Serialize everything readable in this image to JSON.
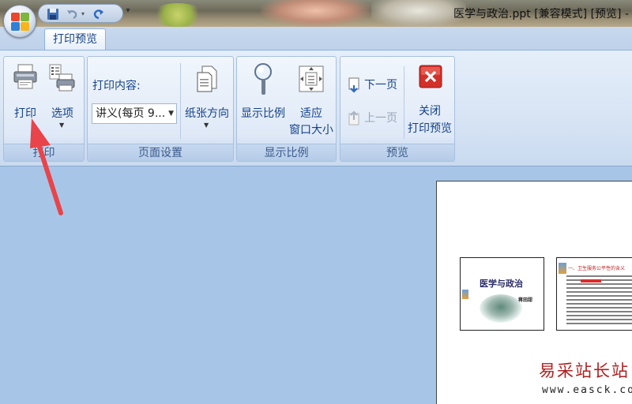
{
  "window": {
    "title": "医学与政治.ppt [兼容模式] [预览] -"
  },
  "tabs": [
    {
      "label": "打印预览"
    }
  ],
  "groups": {
    "print": {
      "label": "打印",
      "print_button": "打印",
      "options_button": "选项"
    },
    "page_setup": {
      "label": "页面设置",
      "content_label": "打印内容:",
      "content_value": "讲义(每页 9...",
      "orientation_button": "纸张方向"
    },
    "zoom": {
      "label": "显示比例",
      "zoom_button": "显示比例",
      "fit_line1": "适应",
      "fit_line2": "窗口大小"
    },
    "preview": {
      "label": "预览",
      "next_page": "下一页",
      "prev_page": "上一页",
      "close_line1": "关闭",
      "close_line2": "打印预览"
    }
  },
  "slides": [
    {
      "title": "医学与政治",
      "author": "蒋田甜"
    },
    {
      "title": "一、卫生服务公平性的含义"
    }
  ],
  "watermark": {
    "site": "易采站长站",
    "url": "www.easck.com"
  },
  "colors": {
    "ribbon_text": "#15428b",
    "background": "#a7c6e7",
    "arrow": "#e8444a",
    "close_icon": "#d3302a"
  },
  "icons": {
    "orb": "office-button-icon",
    "save": "save-icon",
    "undo": "undo-icon",
    "redo": "redo-icon",
    "print": "printer-icon",
    "options": "print-options-icon",
    "orientation": "page-orientation-icon",
    "zoom": "magnifier-icon",
    "fit": "fit-window-icon",
    "next": "next-page-icon",
    "prev": "previous-page-icon",
    "close": "close-preview-icon"
  }
}
